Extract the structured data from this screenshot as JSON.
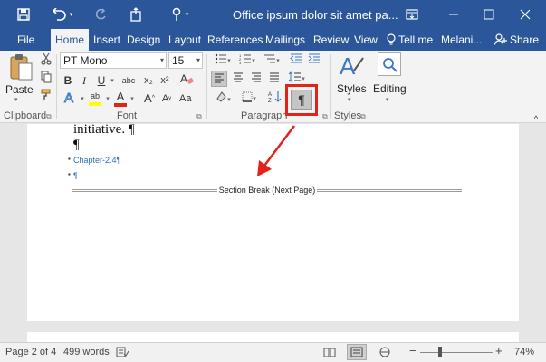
{
  "titlebar": {
    "title": "Office ipsum dolor sit amet  pa...",
    "icons": [
      "save-icon",
      "undo-icon",
      "redo-icon",
      "touch-mode-icon",
      "customize-icon",
      "ribbon-display-icon",
      "minimize-icon",
      "maximize-icon",
      "close-icon"
    ]
  },
  "tabs": [
    "File",
    "Home",
    "Insert",
    "Design",
    "Layout",
    "References",
    "Mailings",
    "Review",
    "View"
  ],
  "tell_me": "Tell me",
  "user": "Melani...",
  "share": "Share",
  "ribbon": {
    "clipboard": {
      "paste": "Paste",
      "label": "Clipboard"
    },
    "font": {
      "name": "PT Mono",
      "size": "15",
      "label": "Font",
      "bold": "B",
      "italic": "I",
      "underline": "U",
      "strike": "abc",
      "subscript": "x₂",
      "superscript": "x²",
      "grow": "A",
      "shrink": "A",
      "highlight": "ab",
      "font_color": "A"
    },
    "paragraph": {
      "label": "Paragraph",
      "show_marks": "¶"
    },
    "styles": {
      "label": "Styles",
      "button": "Styles"
    },
    "editing": {
      "button": "Editing"
    },
    "colors": {
      "highlight": "#ffff00",
      "font_color": "#e2231a",
      "accent": "#2b579a"
    }
  },
  "document": {
    "line1": "initiative. ¶",
    "line2": "¶",
    "bullet1": "Chapter-2.4¶",
    "bullet2": "¶",
    "section_break": "Section Break (Next Page)"
  },
  "status": {
    "page": "Page 2 of 4",
    "words": "499 words",
    "zoom": "74%"
  }
}
